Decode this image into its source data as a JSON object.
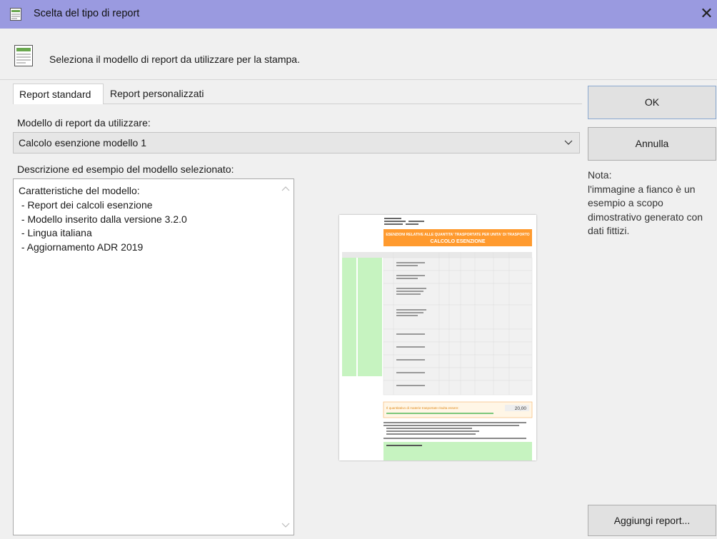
{
  "window": {
    "title": "Scelta del tipo di report",
    "close_glyph": "✕"
  },
  "header": {
    "text": "Seleziona il modello di report da utilizzare per la stampa."
  },
  "tabs": [
    {
      "label": "Report standard"
    },
    {
      "label": "Report personalizzati"
    }
  ],
  "model": {
    "label": "Modello di report da utilizzare:",
    "selected": "Calcolo esenzione modello 1"
  },
  "description": {
    "label": "Descrizione ed esempio del modello selezionato:",
    "text": "Caratteristiche del modello:\n - Report dei calcoli esenzione\n - Modello inserito dalla versione 3.2.0\n - Lingua italiana\n - Aggiornamento ADR 2019"
  },
  "buttons": {
    "ok": "OK",
    "cancel": "Annulla",
    "add_report": "Aggiungi report..."
  },
  "note": "Nota:\nl'immagine a fianco è un esempio a scopo dimostrativo generato con dati fittizi.",
  "preview": {
    "banner_title": "ESENZIONI RELATIVE ALLE QUANTITA' TRASPORTATE PER UNITA' DI TRASPORTO",
    "banner_subtitle": "CALCOLO ESENZIONE",
    "result_label": "Il quantitativo di materie trasportate risulta essere:",
    "result_value": "20,00"
  },
  "colors": {
    "titlebar": "#9a9ae0",
    "banner": "#ff9a2e",
    "green": "#c6f3c0"
  }
}
